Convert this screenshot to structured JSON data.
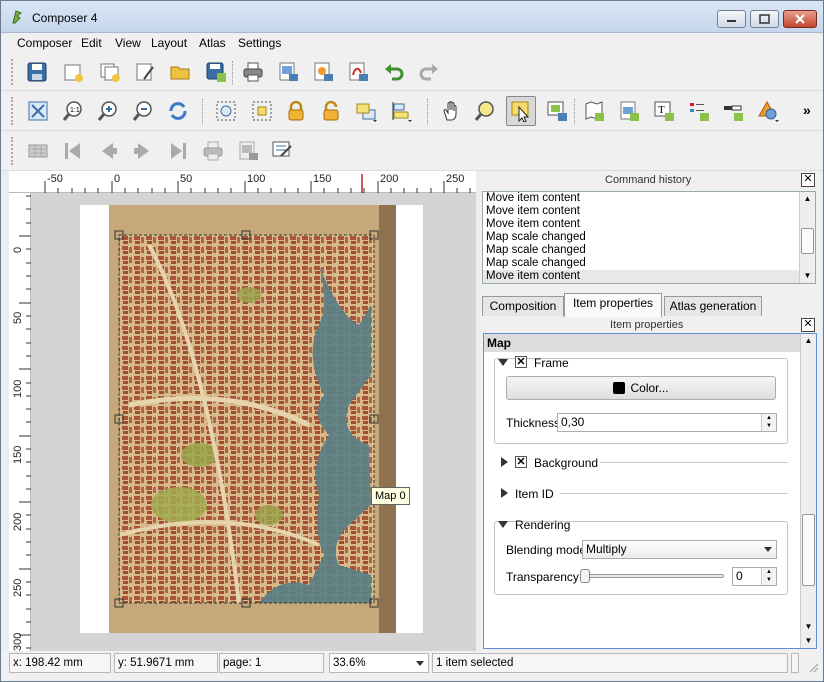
{
  "window": {
    "title": "Composer 4"
  },
  "menubar": {
    "items": [
      "Composer",
      "Edit",
      "View",
      "Layout",
      "Atlas",
      "Settings"
    ]
  },
  "toolbar1": {
    "icons": [
      "save-icon",
      "new-composer-icon",
      "duplicate-composer-icon",
      "composer-manager-icon",
      "open-folder-icon",
      "save-template-icon",
      "print-icon",
      "export-image-icon",
      "export-svg-icon",
      "export-pdf-icon",
      "undo-icon",
      "redo-icon"
    ]
  },
  "toolbar2": {
    "icons": [
      "zoom-full-icon",
      "zoom-actual-icon",
      "zoom-in-icon",
      "zoom-out-icon",
      "refresh-icon",
      "group-icon",
      "ungroup-icon",
      "lock-icon",
      "unlock-icon",
      "raise-icon",
      "align-icon",
      "pan-icon",
      "zoom-tool-icon",
      "select-move-icon",
      "move-content-icon",
      "add-map-icon",
      "add-image-icon",
      "add-label-icon",
      "add-legend-icon",
      "add-scalebar-icon",
      "add-shape-icon"
    ],
    "overflow": "»"
  },
  "toolbar3": {
    "icons": [
      "atlas-preview-icon",
      "first-feature-icon",
      "prev-feature-icon",
      "next-feature-icon",
      "last-feature-icon",
      "print-atlas-icon",
      "export-atlas-icon",
      "atlas-settings-icon"
    ]
  },
  "ruler": {
    "h_ticks": [
      "-50",
      "0",
      "50",
      "100",
      "150",
      "200",
      "250"
    ],
    "v_ticks": [
      "0",
      "50",
      "100",
      "150",
      "200",
      "250",
      "300"
    ]
  },
  "canvas": {
    "tooltip": "Map 0"
  },
  "command_history": {
    "title": "Command history",
    "items": [
      "Move item content",
      "Move item content",
      "Move item content",
      "Map scale changed",
      "Map scale changed",
      "Map scale changed",
      "Move item content"
    ],
    "selected_index": 6
  },
  "tabs": [
    "Composition",
    "Item properties",
    "Atlas generation"
  ],
  "active_tab": 1,
  "item_properties": {
    "title": "Item properties",
    "header": "Map",
    "frame": {
      "label": "Frame",
      "checked": true,
      "color_button": "Color...",
      "color": "#000000",
      "thickness_label": "Thickness",
      "thickness": "0,30"
    },
    "background": {
      "label": "Background",
      "checked": true
    },
    "item_id": {
      "label": "Item ID"
    },
    "rendering": {
      "label": "Rendering",
      "blending_label": "Blending mode",
      "blending_mode": "Multiply",
      "transparency_label": "Transparency",
      "transparency": "0"
    }
  },
  "statusbar": {
    "x": "x: 198.42 mm",
    "y": "y: 51.9671 mm",
    "page": "page: 1",
    "zoom": "33.6%",
    "selection": "1 item selected"
  }
}
